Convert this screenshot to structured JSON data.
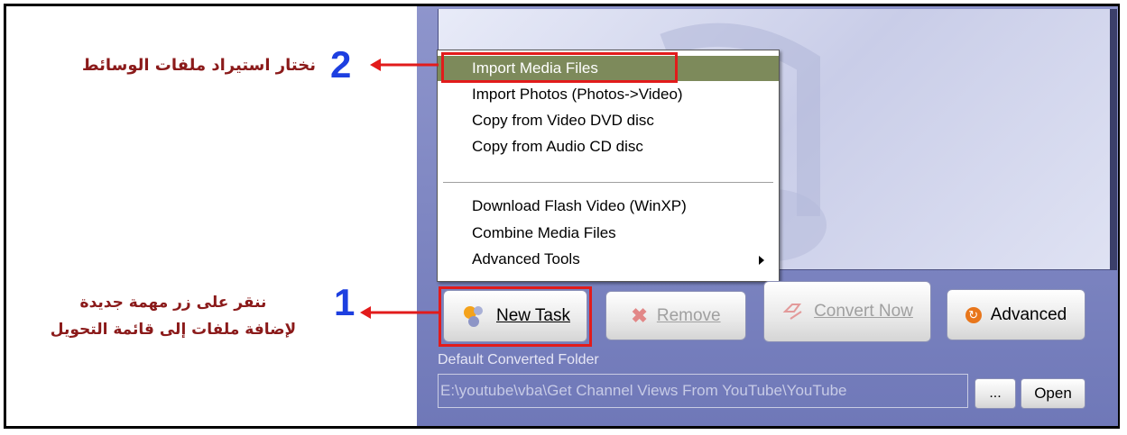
{
  "annotations": {
    "step2": {
      "number": "2",
      "text": "نختار استيراد ملفات الوسائط"
    },
    "step1": {
      "number": "1",
      "line1": "ننقر على زر مهمة جديدة",
      "line2": "لإضافة ملفات إلى قائمة التحويل"
    }
  },
  "menu": {
    "items": [
      {
        "label": "Import Media Files",
        "selected": true
      },
      {
        "label": "Import Photos (Photos->Video)"
      },
      {
        "label": "Copy from Video DVD disc"
      },
      {
        "label": "Copy from Audio CD disc"
      },
      {
        "label": "Download Flash Video (WinXP)"
      },
      {
        "label": "Combine Media Files"
      },
      {
        "label": "Advanced Tools",
        "submenu": true
      }
    ]
  },
  "buttons": {
    "new_task": "New Task",
    "remove": "Remove",
    "convert_now": "Convert Now",
    "advanced": "Advanced",
    "browse": "...",
    "open": "Open"
  },
  "output": {
    "label": "Default Converted Folder",
    "path": "E:\\youtube\\vba\\Get Channel Views From YouTube\\YouTube"
  },
  "colors": {
    "annotation_text": "#8b1a1a",
    "step_number": "#1d3fe0",
    "highlight_box": "#e21b1b",
    "menu_selected": "#7d8a5b",
    "panel": "#7a82bf"
  }
}
